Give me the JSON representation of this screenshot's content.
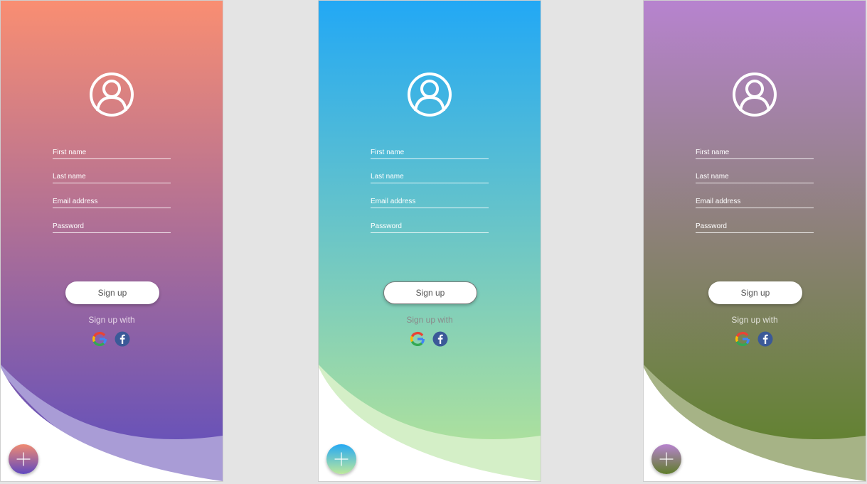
{
  "cards": [
    {
      "first_name_placeholder": "First name",
      "last_name_placeholder": "Last name",
      "email_placeholder": "Email address",
      "password_placeholder": "Password",
      "signup_label": "Sign up",
      "signup_with_label": "Sign up with"
    },
    {
      "first_name_placeholder": "First name",
      "last_name_placeholder": "Last name",
      "email_placeholder": "Email address",
      "password_placeholder": "Password",
      "signup_label": "Sign up",
      "signup_with_label": "Sign up with"
    },
    {
      "first_name_placeholder": "First name",
      "last_name_placeholder": "Last name",
      "email_placeholder": "Email address",
      "password_placeholder": "Password",
      "signup_label": "Sign up",
      "signup_with_label": "Sign up with"
    }
  ],
  "themes": [
    {
      "gradient_top": "#f98e72",
      "gradient_bottom": "#5c4dbe",
      "curve_fill": "#a99cd6"
    },
    {
      "gradient_top": "#22a8f5",
      "gradient_bottom": "#b8e596",
      "curve_fill": "#d4efc7"
    },
    {
      "gradient_top": "#b783cf",
      "gradient_bottom": "#5b8225",
      "curve_fill": "#a6b386"
    }
  ],
  "icons": {
    "avatar": "user-circle-icon",
    "google": "google-icon",
    "facebook": "facebook-icon",
    "fab": "plus-icon"
  }
}
